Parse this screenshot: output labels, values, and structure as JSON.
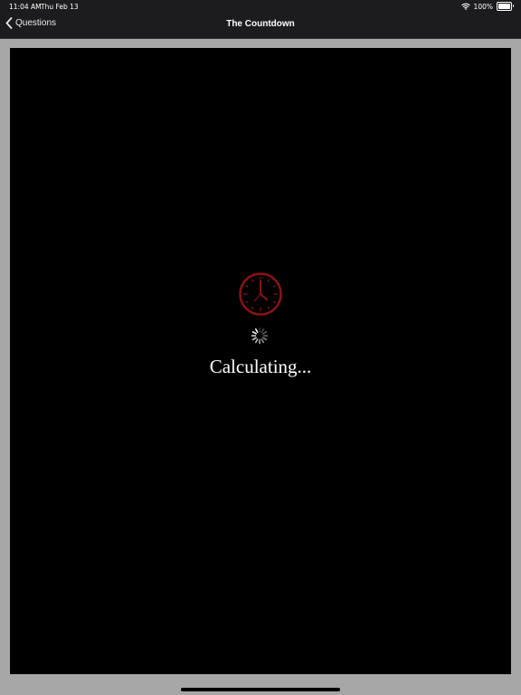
{
  "status_bar": {
    "time": "11:04 AM",
    "date": "Thu Feb 13",
    "battery": "100%"
  },
  "nav": {
    "back_label": "Questions",
    "title": "The Countdown"
  },
  "main": {
    "loading_text": "Calculating..."
  },
  "colors": {
    "clock_red": "#8b1212",
    "background": "#000000",
    "frame": "#a7a7a7"
  },
  "icons": {
    "back": "chevron-left-icon",
    "clock": "clock-icon",
    "spinner": "activity-spinner-icon",
    "wifi": "wifi-icon",
    "battery": "battery-icon"
  }
}
